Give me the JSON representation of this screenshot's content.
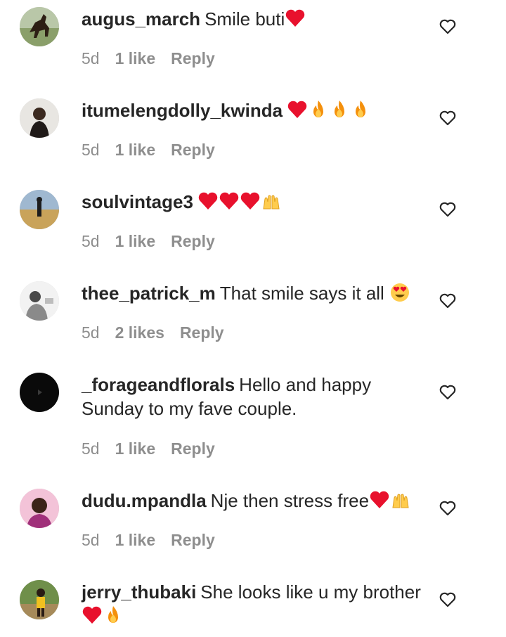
{
  "comments": [
    {
      "username": "augus_march",
      "text": "Smile buti",
      "emojis": [
        "heart"
      ],
      "time": "5d",
      "likes": "1 like",
      "reply": "Reply",
      "avatar": "horse-photo"
    },
    {
      "username": "itumelengdolly_kwinda",
      "text": "",
      "emojis": [
        "heart",
        "fire",
        "fire",
        "fire"
      ],
      "time": "5d",
      "likes": "1 like",
      "reply": "Reply",
      "avatar": "person-photo"
    },
    {
      "username": "soulvintage3",
      "text": "",
      "emojis": [
        "heart",
        "heart",
        "heart",
        "raised-hands"
      ],
      "time": "5d",
      "likes": "1 like",
      "reply": "Reply",
      "avatar": "field-photo"
    },
    {
      "username": "thee_patrick_m",
      "text": "That smile says it all",
      "emojis": [
        "heart-eyes"
      ],
      "time": "5d",
      "likes": "2 likes",
      "reply": "Reply",
      "avatar": "bw-photo"
    },
    {
      "username": "_forageandflorals",
      "text": "Hello and happy Sunday to my fave couple.",
      "emojis": [],
      "time": "5d",
      "likes": "1 like",
      "reply": "Reply",
      "avatar": "black-logo"
    },
    {
      "username": "dudu.mpandla",
      "text": "Nje then stress free",
      "emojis": [
        "heart",
        "raised-hands"
      ],
      "time": "5d",
      "likes": "1 like",
      "reply": "Reply",
      "avatar": "pink-photo"
    },
    {
      "username": "jerry_thubaki",
      "text": "She looks like u my brother",
      "emojis": [
        "heart",
        "fire"
      ],
      "time": "",
      "likes": "",
      "reply": "",
      "avatar": "outdoor-photo"
    }
  ],
  "colors": {
    "text": "#262626",
    "secondary": "#8e8e8e",
    "heart_emoji": "#e8112d",
    "fire_emoji": "#f4900c"
  }
}
